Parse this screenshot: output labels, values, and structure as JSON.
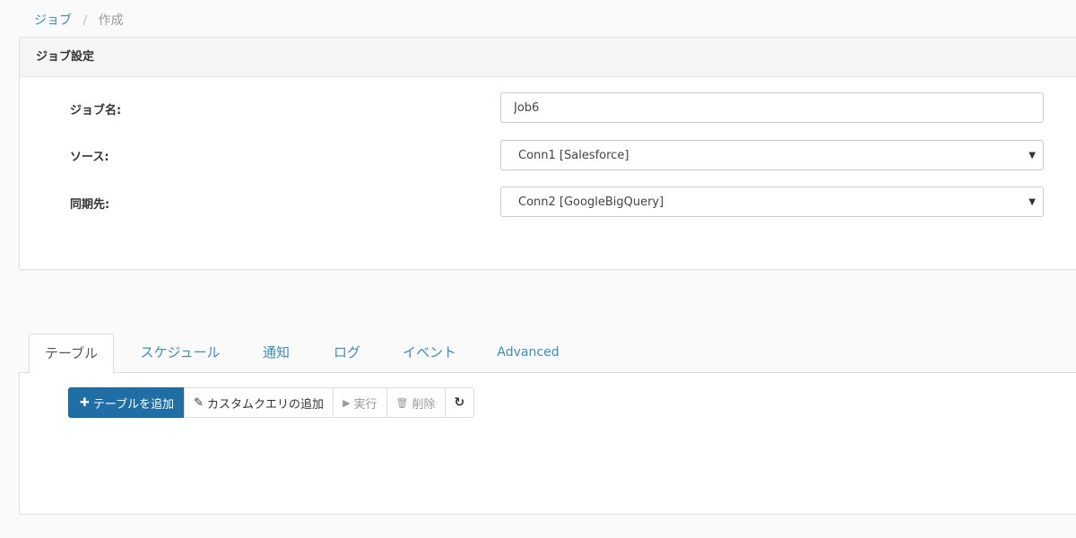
{
  "breadcrumb": {
    "parent": "ジョブ",
    "separator": "/",
    "current": "作成"
  },
  "job_settings": {
    "title": "ジョブ設定",
    "name_label": "ジョブ名:",
    "name_value": "Job6",
    "source_label": "ソース:",
    "source_value": "Conn1 [Salesforce]",
    "dest_label": "同期先:",
    "dest_value": "Conn2 [GoogleBigQuery]",
    "caret": "▼"
  },
  "tabs": {
    "table": "テーブル",
    "schedule": "スケジュール",
    "notify": "通知",
    "log": "ログ",
    "event": "イベント",
    "advanced": "Advanced"
  },
  "toolbar": {
    "add_table": "テーブルを追加",
    "add_custom_query": "カスタムクエリの追加",
    "run": "実行",
    "delete": "削除"
  },
  "icons": {
    "plus": "✚",
    "edit": "✎",
    "play": "▶",
    "trash": "🗑",
    "refresh": "↻"
  },
  "colors": {
    "primary": "#1f6fa6",
    "link": "#3c8dbc"
  }
}
